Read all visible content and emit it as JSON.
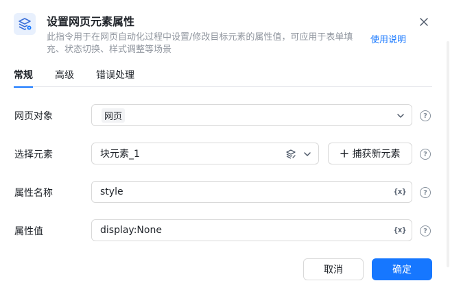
{
  "header": {
    "title": "设置网页元素属性",
    "description": "此指令用于在网页自动化过程中设置/修改目标元素的属性值，可应用于表单填充、状态切换、样式调整等场景",
    "help_link": "使用说明",
    "icon": "layers-gear-icon"
  },
  "tabs": [
    {
      "label": "常规",
      "active": true
    },
    {
      "label": "高级",
      "active": false
    },
    {
      "label": "错误处理",
      "active": false
    }
  ],
  "fields": {
    "web_object": {
      "label": "网页对象",
      "value": "网页"
    },
    "select_element": {
      "label": "选择元素",
      "value": "块元素_1",
      "capture_label": "捕获新元素"
    },
    "attr_name": {
      "label": "属性名称",
      "value": "style",
      "var_icon": "{x}"
    },
    "attr_value": {
      "label": "属性值",
      "value": "display:None",
      "var_icon": "{x}"
    }
  },
  "help_icon": "?",
  "buttons": {
    "cancel": "取消",
    "ok": "确定"
  },
  "colors": {
    "accent": "#1677ff"
  }
}
